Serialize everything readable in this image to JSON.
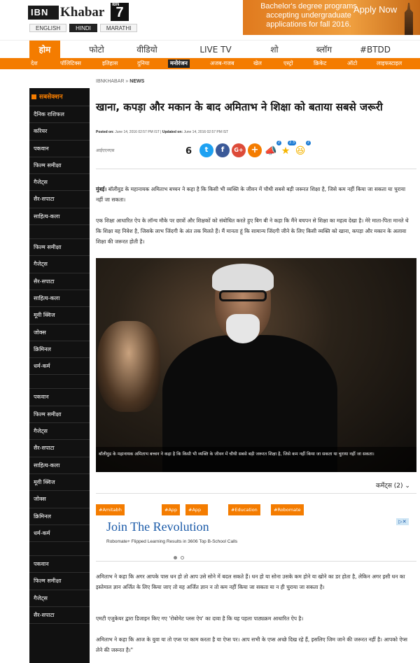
{
  "header": {
    "logo_ibn": "IBN",
    "logo_khabar": "Khabar",
    "logo_badge_text": "IBN",
    "logo_seven": "7",
    "languages": [
      {
        "label": "ENGLISH",
        "active": false
      },
      {
        "label": "HINDI",
        "active": true
      },
      {
        "label": "MARATHI",
        "active": false
      }
    ]
  },
  "ad_banner": {
    "text": "Bachelor's degree programs accepting undergraduate applications for fall 2016.",
    "cta": "Apply Now",
    "color": "#e88a2a"
  },
  "main_nav": [
    {
      "label": "होम",
      "active": true
    },
    {
      "label": "फोटो",
      "active": false
    },
    {
      "label": "वीडियो",
      "active": false
    },
    {
      "label": "LIVE TV",
      "active": false
    },
    {
      "label": "शो",
      "active": false
    },
    {
      "label": "ब्लॉग",
      "active": false
    },
    {
      "label": "#BTDD",
      "active": false
    }
  ],
  "sub_nav": [
    {
      "label": "देश",
      "active": false
    },
    {
      "label": "पॉलिटिक्स",
      "active": false
    },
    {
      "label": "इतिहास",
      "active": false
    },
    {
      "label": "दुनिया",
      "active": false
    },
    {
      "label": "मनोरंजन",
      "active": true
    },
    {
      "label": "अजब-गजब",
      "active": false
    },
    {
      "label": "खेल",
      "active": false
    },
    {
      "label": "एस्ट्रो",
      "active": false
    },
    {
      "label": "क्रिकेट",
      "active": false
    },
    {
      "label": "ऑटो",
      "active": false
    },
    {
      "label": "लाइफस्टाइल",
      "active": false
    }
  ],
  "sidebar": {
    "heading": "सबसेक्शन",
    "groups": [
      [
        "दैनिक राशिफल",
        "करियर",
        "पकवान",
        "फिल्म समीक्षा",
        "गैजेट्स",
        "सैर-सपाटा",
        "साहित्य-कला"
      ],
      [
        "फिल्म समीक्षा",
        "गैजेट्स",
        "सैर-सपाटा",
        "साहित्य-कला",
        "मूवी क्विज",
        "जोक्स",
        "क्रिमिनल",
        "धर्म-कर्म"
      ],
      [
        "पकवान",
        "फिल्म समीक्षा",
        "गैजेट्स",
        "सैर-सपाटा",
        "साहित्य-कला",
        "मूवी क्विज",
        "जोक्स",
        "क्रिमिनल",
        "धर्म-कर्म"
      ],
      [
        "पकवान",
        "फिल्म समीक्षा",
        "गैजेट्स",
        "सैर-सपाटा"
      ]
    ]
  },
  "article": {
    "breadcrumb_site": "IBNKHABAR",
    "breadcrumb_sep": "»",
    "breadcrumb_section": "NEWS",
    "title": "खाना, कपड़ा और मकान के बाद अमिताभ ने शिक्षा को बताया सबसे जरूरी",
    "posted_label": "Posted on:",
    "posted_on": "June 14, 2016 02:57 PM IST",
    "updated_label": "Updated on:",
    "updated_on": "June 14, 2016 02:57 PM IST",
    "agency": "आईएएनएस",
    "share_count": "6",
    "reactions": [
      {
        "icon": "trumpet-icon",
        "count": "2"
      },
      {
        "icon": "star-icon",
        "count": "2.3"
      },
      {
        "icon": "laugh-emoji-icon",
        "count": "2"
      }
    ],
    "para1_dateline": "मुंबई।",
    "para1": " बॉलीवुड के महानायक अमिताभ बच्चन ने कहा है कि किसी भी व्यक्ति के जीवन में चौथी सबसे बड़ी जरूरत शिक्षा है, जिसे कम नहीं किया जा सकता या चुराया नहीं जा सकता।",
    "para2": "एक शिक्षा आधारित ऐप के लॉन्च मौके पर छात्रों और शिक्षकों को संबोधित करते हुए बिग बी ने कहा कि मैंने बचपन से शिक्षा का महत्व देखा है। मेरे माता-पिता मानते थे कि शिक्षा वह निवेश है, जिसके लाभ जिंदगी के अंत तक मिलते हैं। मैं मानता हूं कि सामान्य जिंदगी जीने के लिए किसी व्यक्ति को खाना, कपड़ा और मकान के अलावा शिक्षा की जरूरत होती है।",
    "photo_caption": "बॉलीवुड के महानायक अमिताभ बच्चन ने कहा है कि किसी भी व्यक्ति के जीवन में चौथी सबसे बड़ी जरूरत शिक्षा है, जिसे कम नहीं किया जा सकता या चुराया नहीं जा सकता।",
    "comments_label": "कमेंट्स (2)",
    "tags": [
      "#Amitabh bachchan",
      "#App",
      "#App Launch",
      "#Education",
      "#Robomate Plus App"
    ],
    "para3": "अमिताभ ने कहा कि अगर आपके पास धन हो तो आप उसे सोने में बदल सकते हैं। धन हो या सोना उसके कम होने या खोने का डर होता है, लेकिन अगर इसी धन का इस्तेमाल ज्ञान अर्जित के लिए किया जाए तो यह अर्जित ज्ञान न तो कम नहीं किया जा सकता या न ही चुराया जा सकता है।",
    "para4": "एमटी एजुकेयर द्वारा डिजाइन किए गए 'रोबोमेट प्लस ऐप' का दावा है कि यह पहला पाठ्यक्रम आधारित ऐप है।",
    "para5": "अमिताभ ने कहा कि आज के युवा या तो एप्स पर काम करता है या ऐप्स पर। आप सभी के एप्स अच्छे दिख रहे हैं, इसलिए जिम जाने की जरूरत नहीं है। आपको ऐप्स लेने की जरूरत है।\""
  },
  "promo": {
    "headline": "Join The Revolution",
    "subline": "Robomate+ Flipped Learning Results in 3606 Top B-School Calls",
    "close_icon": "ad-choices-icon"
  },
  "colors": {
    "accent": "#f47c00",
    "sidebar": "#111111",
    "link": "#1a5aa8"
  }
}
